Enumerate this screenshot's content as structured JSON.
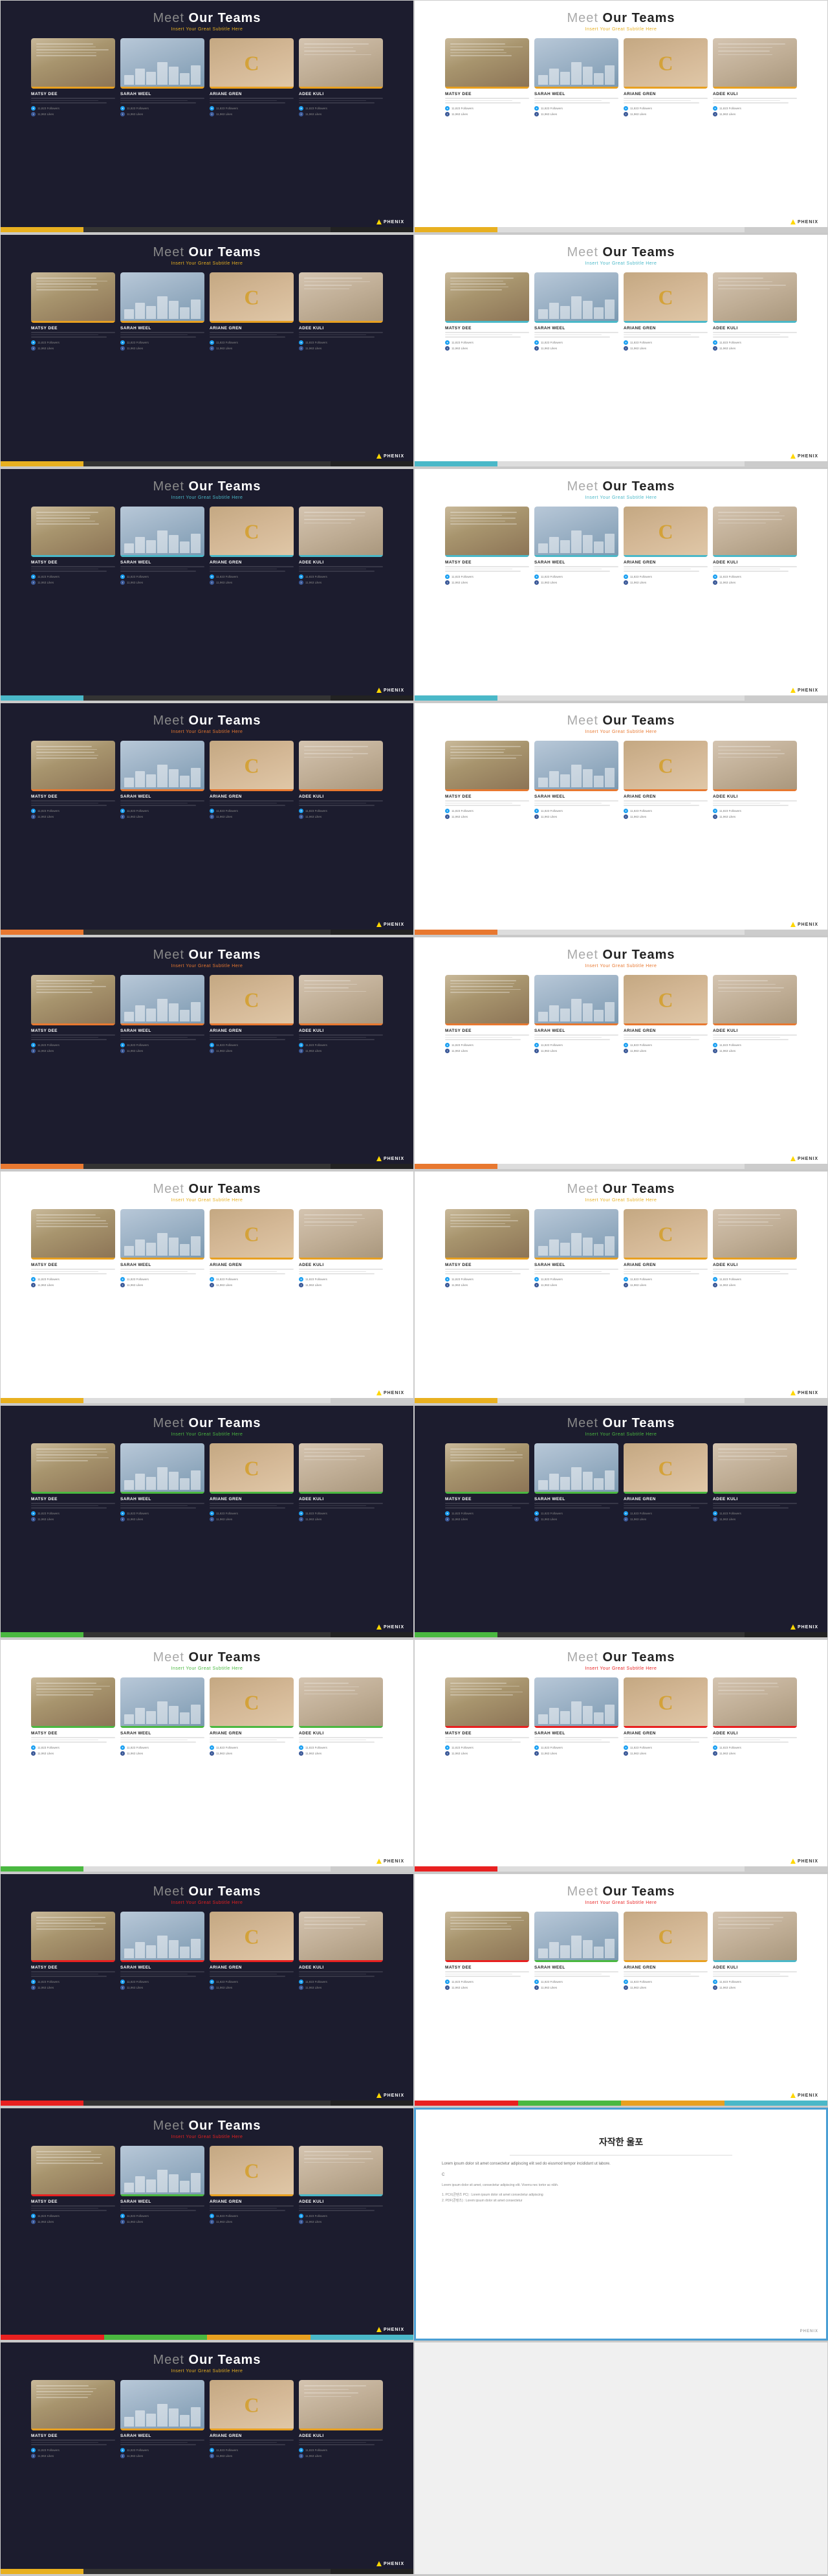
{
  "slides": [
    {
      "id": "s1",
      "theme": "dark",
      "row": 1,
      "col": 1,
      "title_meet": "Meet",
      "title_teams": " Our Teams",
      "subtitle": "Insert Your Great Subtitle Here",
      "members": [
        {
          "name": "MATSY DEE",
          "photo": "doc",
          "color": "#e8a020"
        },
        {
          "name": "SARAH WEEL",
          "photo": "chart",
          "color": "#e8a020"
        },
        {
          "name": "ARIANE GREN",
          "photo": "cletter",
          "color": "#e8a020"
        },
        {
          "name": "ADEE KULI",
          "photo": "notebook",
          "color": "#e8a020"
        }
      ],
      "accent_colors": [
        "#e8b020",
        "#444",
        "#222"
      ],
      "logo": "PHENIX"
    },
    {
      "id": "s2",
      "theme": "light",
      "row": 1,
      "col": 2,
      "title_meet": "Meet",
      "title_teams": " Our Teams",
      "subtitle": "Insert Your Great Subtitle Here",
      "members": [
        {
          "name": "MATSY DEE",
          "photo": "doc",
          "color": "#e8a020"
        },
        {
          "name": "SARAH WEEL",
          "photo": "chart",
          "color": "#e8a020"
        },
        {
          "name": "ARIANE GREN",
          "photo": "cletter",
          "color": "#e8a020"
        },
        {
          "name": "ADEE KULI",
          "photo": "notebook",
          "color": "#e8a020"
        }
      ],
      "accent_colors": [
        "#e8b020",
        "#ccc",
        "#eee"
      ],
      "logo": "PHENIX"
    },
    {
      "id": "s3",
      "theme": "dark",
      "row": 2,
      "col": 1,
      "title_meet": "Meet",
      "title_teams": " Our Teams",
      "subtitle": "Insert Your Great Subtitle Here",
      "members": [
        {
          "name": "MATSY DEE",
          "photo": "doc",
          "color": "#e8a020"
        },
        {
          "name": "SARAH WEEL",
          "photo": "chart",
          "color": "#e8a020"
        },
        {
          "name": "ARIANE GREN",
          "photo": "cletter",
          "color": "#e8a020"
        },
        {
          "name": "ADEE KULI",
          "photo": "notebook",
          "color": "#e8a020"
        }
      ],
      "accent_colors": [
        "#e8b020",
        "#444",
        "#222"
      ],
      "logo": "PHENIX"
    },
    {
      "id": "s4",
      "theme": "light",
      "row": 2,
      "col": 2,
      "title_meet": "Meet",
      "title_teams": " Our Teams",
      "subtitle": "Insert Your Great Subtitle Here",
      "members": [
        {
          "name": "MATSY DEE",
          "photo": "doc",
          "color": "#4ab8c8"
        },
        {
          "name": "SARAH WEEL",
          "photo": "chart",
          "color": "#4ab8c8"
        },
        {
          "name": "ARIANE GREN",
          "photo": "cletter",
          "color": "#4ab8c8"
        },
        {
          "name": "ADEE KULI",
          "photo": "notebook",
          "color": "#4ab8c8"
        }
      ],
      "accent_colors": [
        "#4ab8c8",
        "#ccc",
        "#eee"
      ],
      "logo": "PHENIX"
    },
    {
      "id": "s5",
      "theme": "dark",
      "row": 3,
      "col": 1,
      "title_meet": "Meet",
      "title_teams": " Our Teams",
      "subtitle": "Insert Your Great Subtitle Here",
      "members": [
        {
          "name": "MATSY DEE",
          "photo": "doc",
          "color": "#4ab8c8"
        },
        {
          "name": "SARAH WEEL",
          "photo": "chart",
          "color": "#4ab8c8"
        },
        {
          "name": "ARIANE GREN",
          "photo": "cletter",
          "color": "#4ab8c8"
        },
        {
          "name": "ADEE KULI",
          "photo": "notebook",
          "color": "#4ab8c8"
        }
      ],
      "accent_colors": [
        "#4ab8c8",
        "#444",
        "#222"
      ],
      "logo": "PHENIX"
    },
    {
      "id": "s6",
      "theme": "light",
      "row": 3,
      "col": 2,
      "title_meet": "Meet",
      "title_teams": " Our Teams",
      "subtitle": "Insert Your Great Subtitle Here",
      "members": [
        {
          "name": "MATSY DEE",
          "photo": "doc",
          "color": "#4ab8c8"
        },
        {
          "name": "SARAH WEEL",
          "photo": "chart",
          "color": "#4ab8c8"
        },
        {
          "name": "ARIANE GREN",
          "photo": "cletter",
          "color": "#4ab8c8"
        },
        {
          "name": "ADEE KULI",
          "photo": "notebook",
          "color": "#4ab8c8"
        }
      ],
      "accent_colors": [
        "#4ab8c8",
        "#ccc",
        "#eee"
      ],
      "logo": "PHENIX"
    },
    {
      "id": "s7",
      "theme": "dark",
      "row": 4,
      "col": 1,
      "title_meet": "Meet",
      "title_teams": " Our Teams",
      "subtitle": "Insert Your Great Subtitle Here",
      "members": [
        {
          "name": "MATSY DEE",
          "photo": "doc",
          "color": "#e87830"
        },
        {
          "name": "SARAH WEEL",
          "photo": "chart",
          "color": "#e87830"
        },
        {
          "name": "ARIANE GREN",
          "photo": "cletter",
          "color": "#e87830"
        },
        {
          "name": "ADEE KULI",
          "photo": "notebook",
          "color": "#e87830"
        }
      ],
      "accent_colors": [
        "#e87830",
        "#444",
        "#222"
      ],
      "logo": "PHENIX"
    },
    {
      "id": "s8",
      "theme": "light",
      "row": 4,
      "col": 2,
      "title_meet": "Meet",
      "title_teams": " Our Teams",
      "subtitle": "Insert Your Great Subtitle Here",
      "members": [
        {
          "name": "MATSY DEE",
          "photo": "doc",
          "color": "#e87830"
        },
        {
          "name": "SARAH WEEL",
          "photo": "chart",
          "color": "#e87830"
        },
        {
          "name": "ARIANE GREN",
          "photo": "cletter",
          "color": "#e87830"
        },
        {
          "name": "ADEE KULI",
          "photo": "notebook",
          "color": "#e87830"
        }
      ],
      "accent_colors": [
        "#e87830",
        "#ccc",
        "#eee"
      ],
      "logo": "PHENIX"
    },
    {
      "id": "s9",
      "theme": "dark",
      "row": 5,
      "col": 1,
      "title_meet": "Meet",
      "title_teams": " Our Teams",
      "subtitle": "Insert Your Great Subtitle Here",
      "members": [
        {
          "name": "MATSY DEE",
          "photo": "doc",
          "color": "#e87830"
        },
        {
          "name": "SARAH WEEL",
          "photo": "chart",
          "color": "#e87830"
        },
        {
          "name": "ARIANE GREN",
          "photo": "cletter",
          "color": "#e87830"
        },
        {
          "name": "ADEE KULI",
          "photo": "notebook",
          "color": "#e87830"
        }
      ],
      "accent_colors": [
        "#e87830",
        "#444",
        "#222"
      ],
      "logo": "PHENIX"
    },
    {
      "id": "s10",
      "theme": "light",
      "row": 5,
      "col": 2,
      "title_meet": "Meet",
      "title_teams": " Our Teams",
      "subtitle": "Insert Your Great Subtitle Here",
      "members": [
        {
          "name": "MATSY DEE",
          "photo": "doc",
          "color": "#e87830"
        },
        {
          "name": "SARAH WEEL",
          "photo": "chart",
          "color": "#e87830"
        },
        {
          "name": "ARIANE GREN",
          "photo": "cletter",
          "color": "#e87830"
        },
        {
          "name": "ADEE KULI",
          "photo": "notebook",
          "color": "#e87830"
        }
      ],
      "accent_colors": [
        "#e87830",
        "#ccc",
        "#eee"
      ],
      "logo": "PHENIX"
    },
    {
      "id": "s11",
      "theme": "light",
      "row": 6,
      "col": 1,
      "title_meet": "Meet",
      "title_teams": " Our Teams",
      "subtitle": "Insert Your Great Subtitle Here",
      "members": [
        {
          "name": "MATSY DEE",
          "photo": "doc",
          "color": "#e8a020"
        },
        {
          "name": "SARAH WEEL",
          "photo": "chart",
          "color": "#e8a020"
        },
        {
          "name": "ARIANE GREN",
          "photo": "cletter",
          "color": "#e8a020"
        },
        {
          "name": "ADEE KULI",
          "photo": "notebook",
          "color": "#e8a020"
        }
      ],
      "accent_colors": [
        "#e8b020",
        "#ccc",
        "#eee"
      ],
      "logo": "PHENIX"
    },
    {
      "id": "s12",
      "theme": "light",
      "row": 6,
      "col": 2,
      "title_meet": "Meet",
      "title_teams": " Our Teams",
      "subtitle": "Insert Your Great Subtitle Here",
      "members": [
        {
          "name": "MATSY DEE",
          "photo": "doc",
          "color": "#e8a020"
        },
        {
          "name": "SARAH WEEL",
          "photo": "chart",
          "color": "#e8a020"
        },
        {
          "name": "ARIANE GREN",
          "photo": "cletter",
          "color": "#e8a020"
        },
        {
          "name": "ADEE KULI",
          "photo": "notebook",
          "color": "#e8a020"
        }
      ],
      "accent_colors": [
        "#e8b020",
        "#ccc",
        "#eee"
      ],
      "logo": "PHENIX"
    },
    {
      "id": "s13",
      "theme": "dark",
      "row": 7,
      "col": 1,
      "title_meet": "Meet",
      "title_teams": " Our Teams",
      "subtitle": "Insert Your Great Subtitle Here",
      "members": [
        {
          "name": "MATSY DEE",
          "photo": "doc",
          "color": "#4ab840"
        },
        {
          "name": "SARAH WEEL",
          "photo": "chart",
          "color": "#4ab840"
        },
        {
          "name": "ARIANE GREN",
          "photo": "cletter",
          "color": "#4ab840"
        },
        {
          "name": "ADEE KULI",
          "photo": "notebook",
          "color": "#4ab840"
        }
      ],
      "accent_colors": [
        "#4ab840",
        "#444",
        "#222"
      ],
      "logo": "PHENIX"
    },
    {
      "id": "s14",
      "theme": "dark",
      "row": 7,
      "col": 2,
      "title_meet": "Meet",
      "title_teams": " Our Teams",
      "subtitle": "Insert Your Great Subtitle Here",
      "members": [
        {
          "name": "MATSY DEE",
          "photo": "doc",
          "color": "#4ab840"
        },
        {
          "name": "SARAH WEEL",
          "photo": "chart",
          "color": "#4ab840"
        },
        {
          "name": "ARIANE GREN",
          "photo": "cletter",
          "color": "#4ab840"
        },
        {
          "name": "ADEE KULI",
          "photo": "notebook",
          "color": "#4ab840"
        }
      ],
      "accent_colors": [
        "#4ab840",
        "#444",
        "#222"
      ],
      "logo": "PHENIX"
    },
    {
      "id": "s15",
      "theme": "light",
      "row": 8,
      "col": 1,
      "title_meet": "Meet",
      "title_teams": " Our Teams",
      "subtitle": "Insert Your Great Subtitle Here",
      "members": [
        {
          "name": "MATSY DEE",
          "photo": "doc",
          "color": "#4ab840"
        },
        {
          "name": "SARAH WEEL",
          "photo": "chart",
          "color": "#4ab840"
        },
        {
          "name": "ARIANE GREN",
          "photo": "cletter",
          "color": "#4ab840"
        },
        {
          "name": "ADEE KULI",
          "photo": "notebook",
          "color": "#4ab840"
        }
      ],
      "accent_colors": [
        "#4ab840",
        "#ccc",
        "#eee"
      ],
      "logo": "PHENIX"
    },
    {
      "id": "s16",
      "theme": "light",
      "row": 8,
      "col": 2,
      "title_meet": "Meet",
      "title_teams": " Our Teams",
      "subtitle": "Insert Your Great Subtitle Here",
      "members": [
        {
          "name": "MATSY DEE",
          "photo": "doc",
          "color": "#e82020"
        },
        {
          "name": "SARAH WEEL",
          "photo": "chart",
          "color": "#e82020"
        },
        {
          "name": "ARIANE GREN",
          "photo": "cletter",
          "color": "#e82020"
        },
        {
          "name": "ADEE KULI",
          "photo": "notebook",
          "color": "#e82020"
        }
      ],
      "accent_colors": [
        "#e82020",
        "#ccc",
        "#eee"
      ],
      "logo": "PHENIX"
    },
    {
      "id": "s17",
      "theme": "dark",
      "row": 9,
      "col": 1,
      "title_meet": "Meet",
      "title_teams": " Our Teams",
      "subtitle": "Insert Your Great Subtitle Here",
      "members": [
        {
          "name": "MATSY DEE",
          "photo": "doc",
          "color": "#e82020"
        },
        {
          "name": "SARAH WEEL",
          "photo": "chart",
          "color": "#e82020"
        },
        {
          "name": "ARIANE GREN",
          "photo": "cletter",
          "color": "#e82020"
        },
        {
          "name": "ADEE KULI",
          "photo": "notebook",
          "color": "#e82020"
        }
      ],
      "accent_colors": [
        "#e82020",
        "#444",
        "#222"
      ],
      "logo": "PHENIX"
    },
    {
      "id": "s18",
      "theme": "light_colored",
      "row": 9,
      "col": 2,
      "title_meet": "Meet",
      "title_teams": " Our Teams",
      "subtitle": "Insert Your Great Subtitle Here",
      "members": [
        {
          "name": "MATSY DEE",
          "photo": "doc",
          "color": "#e82020"
        },
        {
          "name": "SARAH WEEL",
          "photo": "chart",
          "color": "#4ab840"
        },
        {
          "name": "ARIANE GREN",
          "photo": "cletter",
          "color": "#e8a020"
        },
        {
          "name": "ADEE KULI",
          "photo": "notebook",
          "color": "#4ab8c8"
        }
      ],
      "accent_colors": [
        "#e82020",
        "#4ab840",
        "#e8a020",
        "#4ab8c8"
      ],
      "logo": "PHENIX"
    },
    {
      "id": "s19",
      "theme": "dark",
      "row": 10,
      "col": 1,
      "title_meet": "Meet",
      "title_teams": " Our Teams",
      "subtitle": "Insert Your Great Subtitle Here",
      "members": [
        {
          "name": "MATSY DEE",
          "photo": "doc",
          "color": "#e82020"
        },
        {
          "name": "SARAH WEEL",
          "photo": "chart",
          "color": "#4ab840"
        },
        {
          "name": "ARIANE GREN",
          "photo": "cletter",
          "color": "#e8a020"
        },
        {
          "name": "ADEE KULI",
          "photo": "notebook",
          "color": "#4ab8c8"
        }
      ],
      "accent_colors": [
        "#e82020",
        "#4ab840",
        "#e8a020",
        "#4ab8c8"
      ],
      "logo": "PHENIX"
    },
    {
      "id": "s20",
      "theme": "korean",
      "row": 10,
      "col": 2,
      "title_meet": "",
      "title_teams": "",
      "subtitle": "",
      "korean_title": "자작한 울포",
      "members": [],
      "accent_colors": [],
      "logo": ""
    },
    {
      "id": "s21",
      "theme": "dark",
      "row": 11,
      "col": 1,
      "title_meet": "Meet",
      "title_teams": " Our Teams",
      "subtitle": "Insert Your Great Subtitle Here",
      "members": [
        {
          "name": "MATSY DEE",
          "photo": "doc",
          "color": "#e8a020"
        },
        {
          "name": "SARAH WEEL",
          "photo": "chart",
          "color": "#e8a020"
        },
        {
          "name": "ARIANE GREN",
          "photo": "cletter",
          "color": "#e8a020"
        },
        {
          "name": "ADEE KULI",
          "photo": "notebook",
          "color": "#e8a020"
        }
      ],
      "accent_colors": [
        "#e8b020",
        "#444",
        "#222"
      ],
      "logo": "PHENIX"
    }
  ],
  "desc_text": "Lorem ipsum dolor sit amet, consectetur adipiscing elit. Viverra.",
  "social_followers": "11823 Followers",
  "social_likes": "11963 Likes"
}
